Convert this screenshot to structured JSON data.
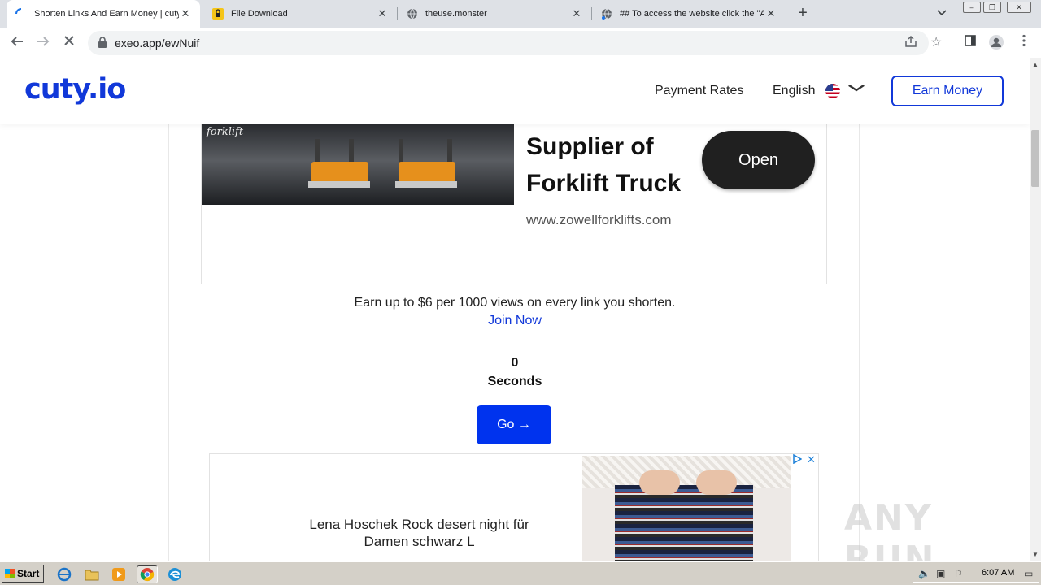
{
  "browser": {
    "tabs": [
      {
        "title": "Shorten Links And Earn Money | cuty",
        "icon": "loading-spinner-icon",
        "active": true
      },
      {
        "title": "File Download",
        "icon": "lock-favicon-icon",
        "active": false
      },
      {
        "title": "theuse.monster",
        "icon": "globe-icon",
        "active": false
      },
      {
        "title": "## To access the website click the \"A",
        "icon": "globe-icon",
        "active": false
      }
    ],
    "tab_close": "✕",
    "new_tab": "+",
    "url": "exeo.app/ewNuif"
  },
  "site": {
    "logo": "cuty.io",
    "nav": {
      "payment_rates": "Payment Rates",
      "language": "English",
      "earn_money": "Earn Money"
    },
    "ad1": {
      "brand": "forklift",
      "title_line1": "Supplier of",
      "title_line2": "Forklift Truck",
      "url": "www.zowellforklifts.com",
      "open": "Open"
    },
    "promo": {
      "text": "Earn up to $6 per 1000 views on every link you shorten.",
      "join": "Join Now"
    },
    "timer": {
      "count": "0",
      "label": "Seconds"
    },
    "go_button": "Go →",
    "ad2": {
      "line1": "Lena Hoschek Rock desert night für",
      "line2": "Damen schwarz L"
    },
    "watermark": "ANY RUN"
  },
  "taskbar": {
    "start": "Start",
    "clock": "6:07 AM"
  },
  "colors": {
    "brand": "#1138d9",
    "go_button": "#0033ee"
  }
}
